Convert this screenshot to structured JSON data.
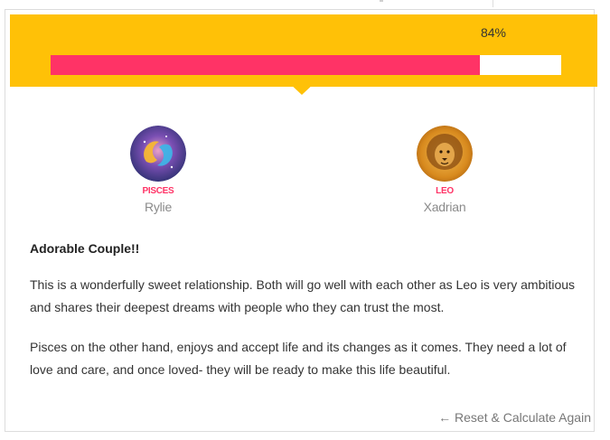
{
  "result": {
    "percent_label": "84%",
    "percent_value": 0.84
  },
  "colors": {
    "banner": "#FFC107",
    "progress_fill": "#FF3366",
    "sign_text": "#FF3366"
  },
  "partners": [
    {
      "sign": "PISCES",
      "name": "Rylie",
      "icon": "pisces-icon"
    },
    {
      "sign": "LEO",
      "name": "Xadrian",
      "icon": "leo-icon"
    }
  ],
  "description": {
    "headline": "Adorable Couple!!",
    "paragraphs": [
      "This is a wonderfully sweet relationship. Both will go well with each other as Leo is very ambitious and shares their deepest dreams with people who they can trust the most.",
      "Pisces on the other hand, enjoys and accept life and its changes as it comes. They need a lot of love and care, and once loved- they will be ready to make this life beautiful."
    ]
  },
  "actions": {
    "reset_label": "← Reset & Calculate Again"
  }
}
